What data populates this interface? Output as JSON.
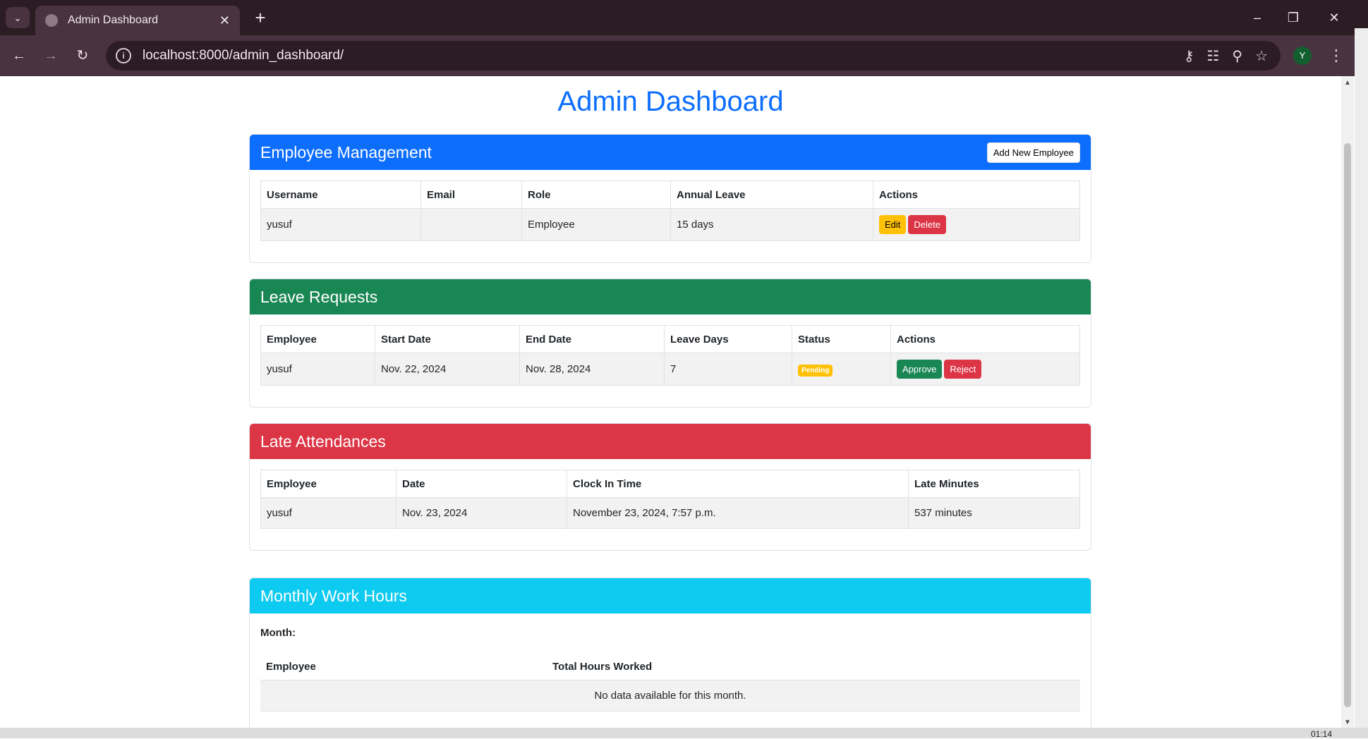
{
  "browser": {
    "tab_title": "Admin Dashboard",
    "url": "localhost:8000/admin_dashboard/",
    "avatar_letter": "Y",
    "clock": "01:14"
  },
  "page": {
    "title": "Admin Dashboard"
  },
  "employee_management": {
    "header": "Employee Management",
    "add_button": "Add New Employee",
    "columns": [
      "Username",
      "Email",
      "Role",
      "Annual Leave",
      "Actions"
    ],
    "rows": [
      {
        "username": "yusuf",
        "email": "",
        "role": "Employee",
        "annual_leave": "15 days",
        "edit_label": "Edit",
        "delete_label": "Delete"
      }
    ]
  },
  "leave_requests": {
    "header": "Leave Requests",
    "columns": [
      "Employee",
      "Start Date",
      "End Date",
      "Leave Days",
      "Status",
      "Actions"
    ],
    "rows": [
      {
        "employee": "yusuf",
        "start_date": "Nov. 22, 2024",
        "end_date": "Nov. 28, 2024",
        "leave_days": "7",
        "status": "Pending",
        "approve_label": "Approve",
        "reject_label": "Reject"
      }
    ]
  },
  "late_attendances": {
    "header": "Late Attendances",
    "columns": [
      "Employee",
      "Date",
      "Clock In Time",
      "Late Minutes"
    ],
    "rows": [
      {
        "employee": "yusuf",
        "date": "Nov. 23, 2024",
        "clock_in": "November 23, 2024, 7:57 p.m.",
        "late_minutes": "537 minutes"
      }
    ]
  },
  "monthly_work_hours": {
    "header": "Monthly Work Hours",
    "month_label": "Month:",
    "columns": [
      "Employee",
      "Total Hours Worked"
    ],
    "empty_message": "No data available for this month."
  },
  "colors": {
    "primary": "#0d6efd",
    "success": "#198754",
    "danger": "#dc3545",
    "info": "#0dcaf0",
    "warning": "#ffc107"
  }
}
